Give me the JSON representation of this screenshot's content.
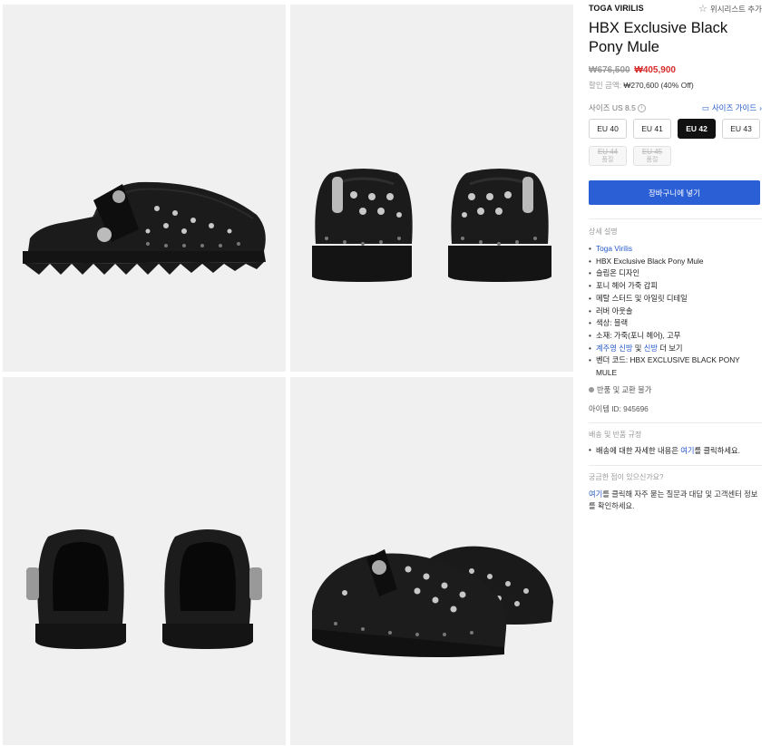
{
  "gallery": {
    "images": [
      {
        "alt": "side view"
      },
      {
        "alt": "front view"
      },
      {
        "alt": "back view"
      },
      {
        "alt": "angled view"
      }
    ]
  },
  "product": {
    "brand": "TOGA VIRILIS",
    "wishlist_label": "위시리스트 추가",
    "title": "HBX Exclusive Black Pony Mule",
    "old_price": "₩676,500",
    "new_price": "₩405,900",
    "discount_label": "할인 금액:",
    "discount_value": "₩270,600 (40% Off)"
  },
  "size": {
    "label": "사이즈 US 8.5",
    "guide_label": "사이즈 가이드",
    "options": [
      {
        "label": "EU 40"
      },
      {
        "label": "EU 41"
      },
      {
        "label": "EU 42"
      },
      {
        "label": "EU 43"
      },
      {
        "label": "EU 44",
        "status": "품절"
      },
      {
        "label": "EU 45",
        "status": "품절"
      }
    ]
  },
  "cart_button": "장바구니에 넣기",
  "details": {
    "title": "상세 설명",
    "brand_link": "Toga Virilis",
    "items": [
      "HBX Exclusive Black Pony Mule",
      "슬립온 디자인",
      "포니 헤어 가죽 갑피",
      "메탈 스터드 및 아일릿 디테일",
      "러버 아웃솔",
      "색상: 블랙",
      "소재: 가죽(포니 헤어), 고무"
    ],
    "more_link1": "계주영 신방",
    "more_and": "및",
    "more_link2": "신방",
    "more_suffix": "더 보기",
    "vendor_code": "벤더 코드: HBX EXCLUSIVE BLACK PONY MULE"
  },
  "returns_label": "반품 및 교환 불가",
  "item_id": "아이템 ID: 945696",
  "shipping": {
    "title": "배송 및 반품 규정",
    "text_before": "배송에 대한 자세한 내용은",
    "link": "여기",
    "text_after": "를 클릭하세요."
  },
  "faq": {
    "title": "궁금한 점이 있으신가요?",
    "link": "여기",
    "text": "를 클릭해 자주 묻는 질문과 대답 및 고객센터 정보를 확인하세요."
  },
  "colors": {
    "accent": "#2b5fd6",
    "sale": "#d72a2a",
    "link": "#2358c8"
  }
}
